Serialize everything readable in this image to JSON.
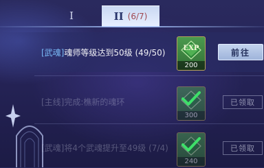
{
  "tabs": [
    {
      "label": "I",
      "progress": ""
    },
    {
      "label": "II",
      "progress": "(6/7)"
    }
  ],
  "tasks": [
    {
      "tag": "[武魂]",
      "text": "魂师等级达到50级 (49/50)",
      "reward_icon": "exp-gem-icon",
      "reward_text": "EXP",
      "reward_amount": "200",
      "action": "前往",
      "status": "in-progress"
    },
    {
      "tag": "[主线]",
      "text": "完成:樵新的魂环",
      "reward_icon": "exp-gem-icon",
      "reward_amount": "300",
      "action": "已领取",
      "status": "claimed"
    },
    {
      "tag": "[武魂]",
      "text": "将4个武魂提升至49级 (7/4)",
      "reward_icon": "exp-gem-icon",
      "reward_amount": "240",
      "action": "已领取",
      "status": "claimed"
    }
  ],
  "colors": {
    "accent": "#79b8f5",
    "progress": "#a04850",
    "reward_bg": "#3a7c3d",
    "check": "#3ee069"
  }
}
